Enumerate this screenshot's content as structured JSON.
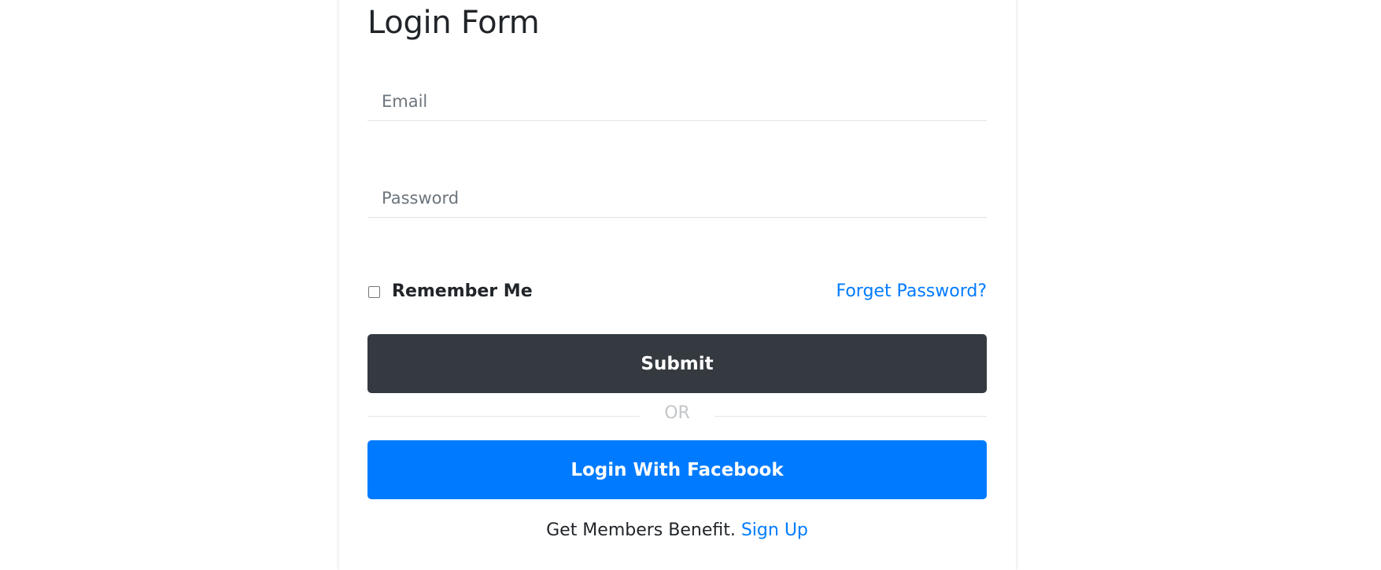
{
  "form": {
    "title": "Login Form",
    "email_placeholder": "Email",
    "password_placeholder": "Password",
    "remember_label": "Remember Me",
    "remember_checked": false,
    "forgot_link": "Forget Password?",
    "submit_label": "Submit",
    "divider_text": "OR",
    "facebook_label": "Login With Facebook",
    "signup_prompt": "Get Members Benefit.",
    "signup_link": "Sign Up"
  },
  "colors": {
    "primary": "#007bff",
    "dark_button": "#343a40",
    "text": "#212529",
    "muted": "#6c757d",
    "divider_text": "#c3c6c9"
  }
}
